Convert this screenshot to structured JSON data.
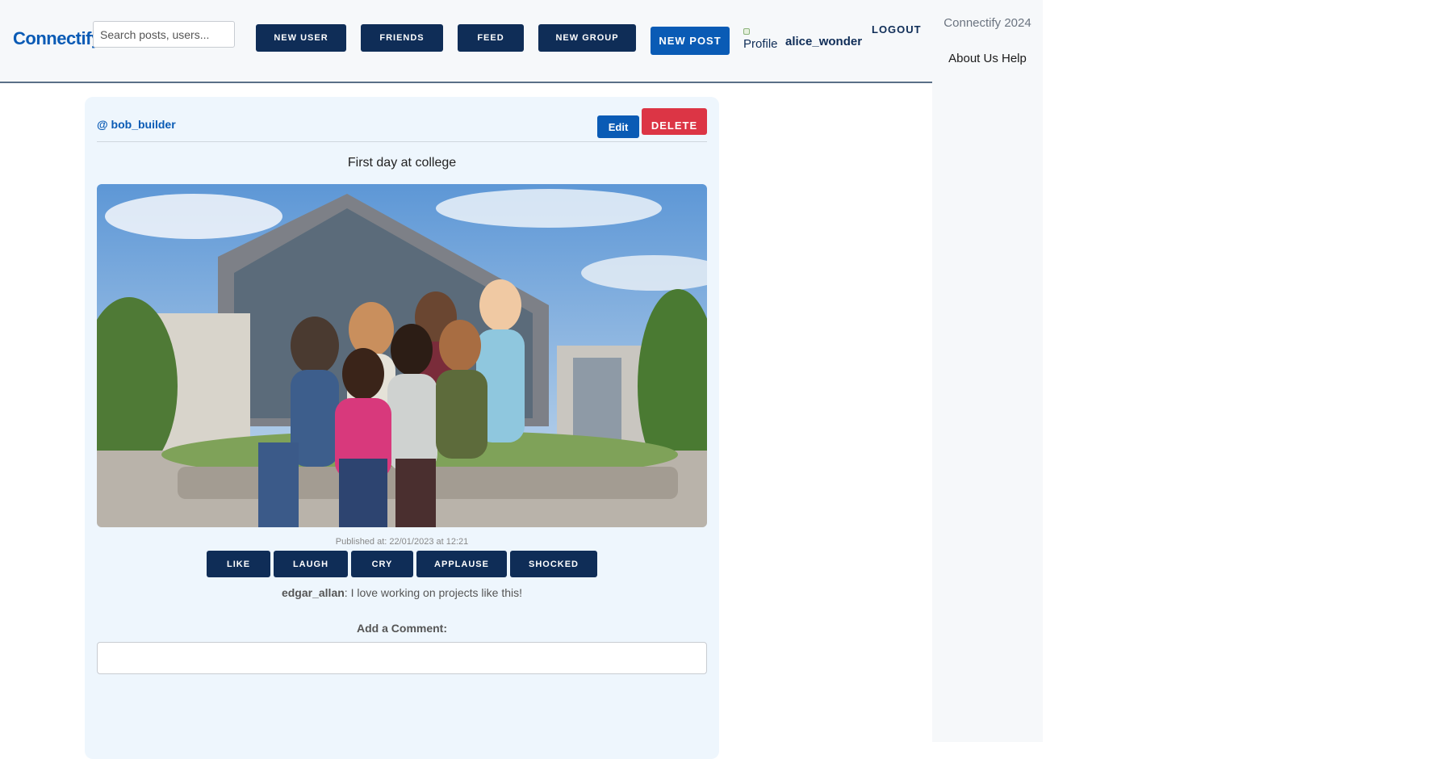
{
  "header": {
    "brand": "Connectify",
    "search_placeholder": "Search posts, users...",
    "nav": [
      "NEW USER",
      "FRIENDS",
      "FEED",
      "NEW GROUP"
    ],
    "new_post": "NEW POST",
    "profile_alt": "Profile",
    "username": "alice_wonder",
    "logout": "LOGOUT"
  },
  "footer": {
    "title": "Connectify 2024",
    "links": "About Us Help"
  },
  "post": {
    "author": "@ bob_builder",
    "edit": "Edit",
    "delete": "DELETE",
    "title": "First day at college",
    "published": "Published at: 22/01/2023 at 12:21",
    "reactions": [
      "LIKE",
      "LAUGH",
      "CRY",
      "APPLAUSE",
      "SHOCKED"
    ],
    "comment_user": "edgar_allan",
    "comment_text": ": I love working on projects like this!",
    "add_comment_label": "Add a Comment:"
  },
  "colors": {
    "brand": "#0a5bb5",
    "nav_button": "#0f2d57",
    "delete": "#dc3545"
  }
}
